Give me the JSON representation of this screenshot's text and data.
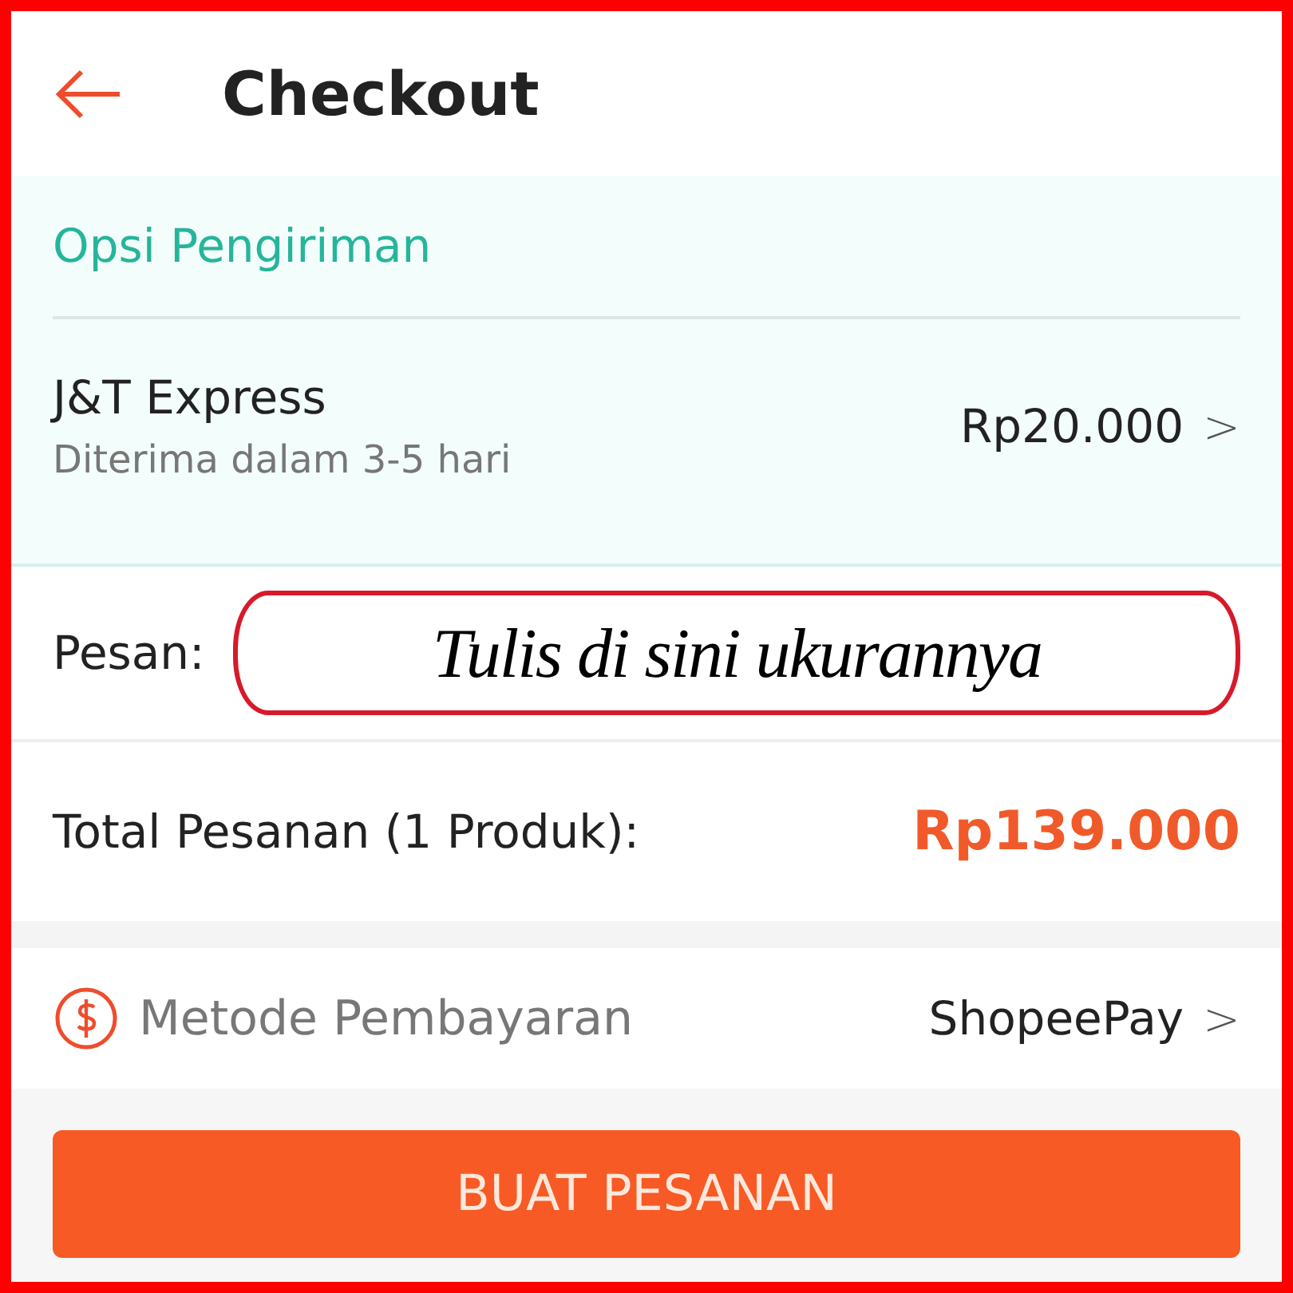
{
  "header": {
    "title": "Checkout"
  },
  "shipping": {
    "heading": "Opsi Pengiriman",
    "courier": "J&T Express",
    "estimate": "Diterima dalam 3-5 hari",
    "price": "Rp20.000",
    "chevron": ">"
  },
  "message": {
    "label": "Pesan:",
    "value": "Tulis di sini ukurannya"
  },
  "total": {
    "label": "Total Pesanan (1 Produk):",
    "amount": "Rp139.000"
  },
  "payment": {
    "label": "Metode Pembayaran",
    "method": "ShopeePay",
    "chevron": ">"
  },
  "primary_button": {
    "label": "BUAT PESANAN"
  }
}
